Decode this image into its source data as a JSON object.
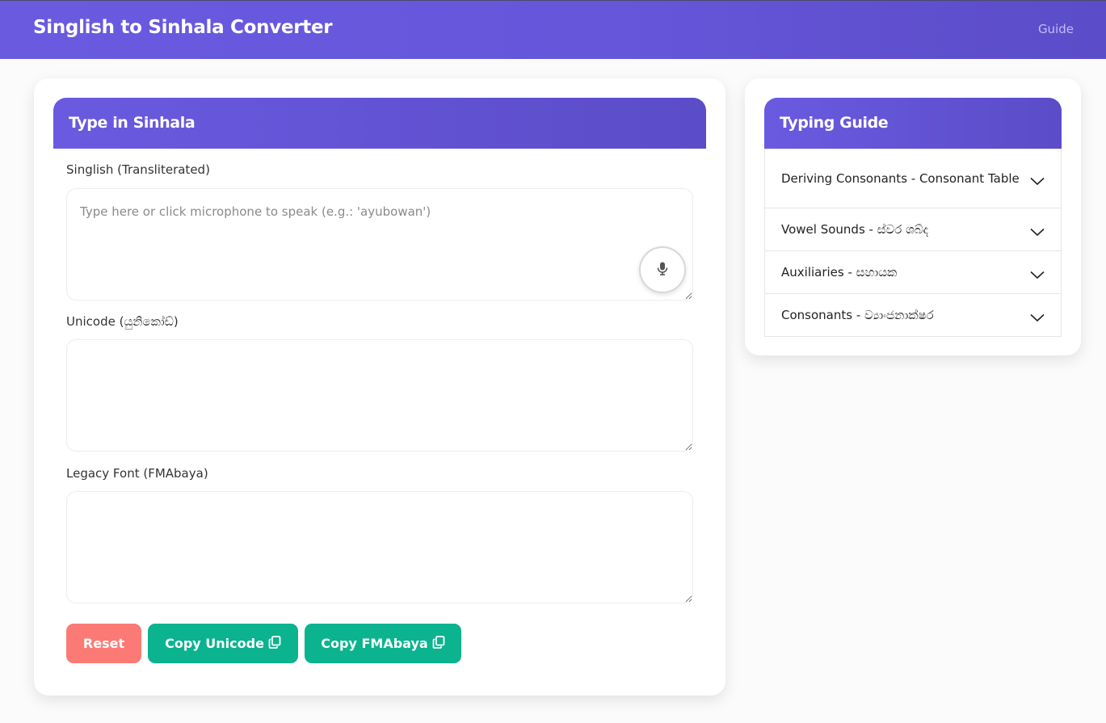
{
  "navbar": {
    "brand": "Singlish to Sinhala Converter",
    "guide_link": "Guide"
  },
  "converter": {
    "title": "Type in Sinhala",
    "singlish": {
      "label": "Singlish (Transliterated)",
      "placeholder": "Type here or click microphone to speak (e.g.: 'ayubowan')",
      "value": ""
    },
    "microphone_icon": "microphone-icon",
    "unicode": {
      "label": "Unicode (යුනිකෝඩ්)",
      "value": ""
    },
    "legacy": {
      "label": "Legacy Font (FMAbaya)",
      "value": ""
    },
    "buttons": {
      "reset": "Reset",
      "copy_unicode": "Copy Unicode",
      "copy_fmabaya": "Copy FMAbaya"
    },
    "copy_icon": "copy-icon"
  },
  "guide": {
    "title": "Typing Guide",
    "items": [
      {
        "label": "Deriving Consonants - Consonant Table"
      },
      {
        "label": "Vowel Sounds - ස්වර ශබ්ද"
      },
      {
        "label": "Auxiliaries - සහායක"
      },
      {
        "label": "Consonants - ව්‍යාංජනාක්ෂර"
      }
    ],
    "expand_icon": "chevron-down-icon"
  },
  "colors": {
    "primary": "#6a5ae0",
    "reset": "#fc7a75",
    "copy": "#0bb38f",
    "background": "#fbfbfc"
  }
}
